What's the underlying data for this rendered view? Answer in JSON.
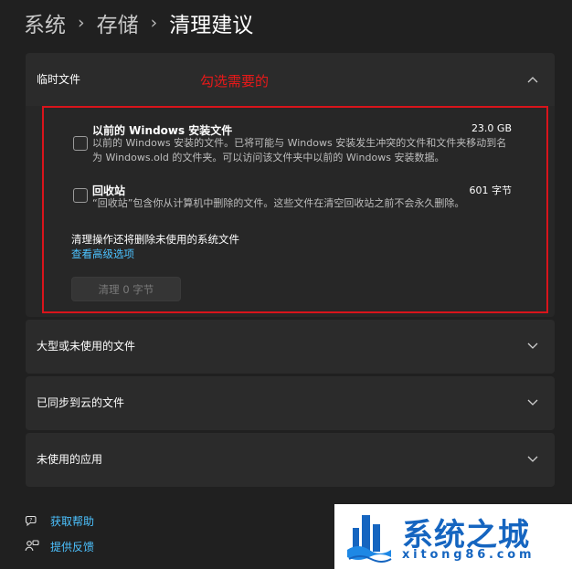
{
  "breadcrumb": {
    "items": [
      "系统",
      "存储",
      "清理建议"
    ],
    "separator": "›"
  },
  "annotation": {
    "label": "勾选需要的",
    "color": "#e81919"
  },
  "sections": [
    {
      "title": "临时文件",
      "expanded": true,
      "options": [
        {
          "title": "以前的 Windows 安装文件",
          "size": "23.0 GB",
          "description": "以前的 Windows 安装的文件。已将可能与 Windows 安装发生冲突的文件和文件夹移动到名为 Windows.old 的文件夹。可以访问该文件夹中以前的 Windows 安装数据。",
          "checked": false
        },
        {
          "title": "回收站",
          "size": "601 字节",
          "description": "“回收站”包含你从计算机中删除的文件。这些文件在清空回收站之前不会永久删除。",
          "checked": false
        }
      ],
      "extra_note": "清理操作还将删除未使用的系统文件",
      "advanced_link": "查看高级选项",
      "clean_button": "清理 0 字节"
    },
    {
      "title": "大型或未使用的文件",
      "expanded": false
    },
    {
      "title": "已同步到云的文件",
      "expanded": false
    },
    {
      "title": "未使用的应用",
      "expanded": false
    }
  ],
  "footer": {
    "help": {
      "label": "获取帮助",
      "icon": "help-icon"
    },
    "feedback": {
      "label": "提供反馈",
      "icon": "feedback-icon"
    }
  },
  "watermark": {
    "title": "系统之城",
    "url": "xitong86.com"
  },
  "colors": {
    "background": "#202020",
    "card": "#2b2b2b",
    "accent_link": "#4cc2ff",
    "highlight_border": "#d9141b",
    "watermark_blue": "#1565c0"
  }
}
